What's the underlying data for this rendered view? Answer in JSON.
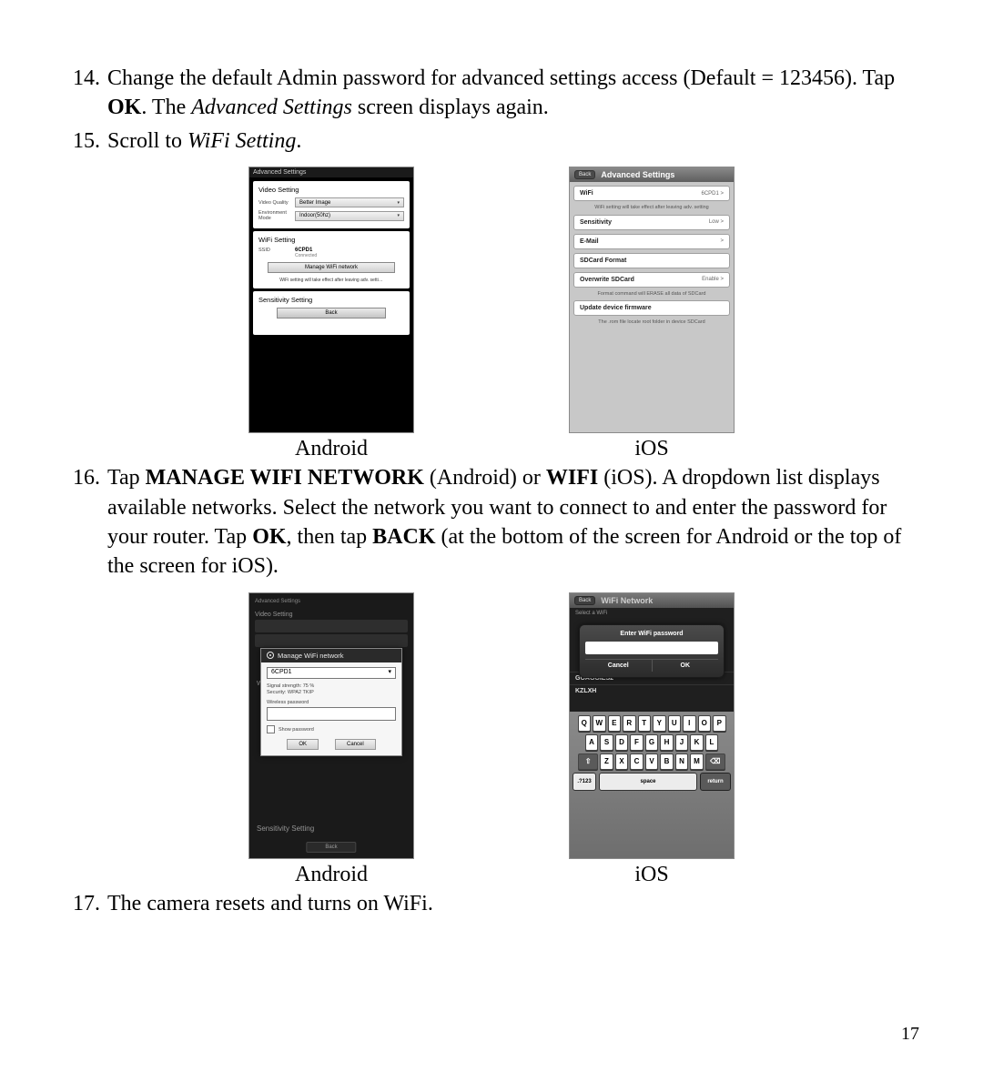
{
  "step14": {
    "num": "14.",
    "text_a": "Change the default Admin password for advanced settings access (Default = 123456). Tap ",
    "ok": "OK",
    "text_b": ". The ",
    "adv": "Advanced Settings",
    "text_c": " screen displays again."
  },
  "step15": {
    "num": "15.",
    "text_a": "Scroll to ",
    "wifi": "WiFi Setting",
    "text_b": "."
  },
  "step16": {
    "num": "16.",
    "text_a": "Tap ",
    "mgn": "MANAGE WIFI NETWORK",
    "text_b": " (Android) or ",
    "wifi": "WIFI",
    "text_c": " (iOS). A dropdown list displays available networks. Select the network you want to connect to and enter the password for your router. Tap ",
    "ok": "OK",
    "text_d": ", then tap ",
    "back": "BACK",
    "text_e": " (at the bottom of the screen for Android or the top of the screen for iOS)."
  },
  "step17": {
    "num": "17.",
    "text": "The camera resets and turns on WiFi."
  },
  "captions": {
    "android": "Android",
    "ios": "iOS"
  },
  "page_number": "17",
  "androidA": {
    "title": "Advanced Settings",
    "video": {
      "heading": "Video Setting",
      "quality_lbl": "Video Quality",
      "quality_val": "Better Image",
      "env_lbl": "Environment Mode",
      "env_val": "Indoor(50hz)"
    },
    "wifi": {
      "heading": "WiFi Setting",
      "ssid_lbl": "SSID",
      "ssid_val": "6CPD1",
      "ssid_status": "Connected",
      "manage_btn": "Manage WiFi network",
      "hint": "WiFi setting will take effect after leaving adv. setti…"
    },
    "sens": {
      "heading": "Sensitivity Setting"
    },
    "back": "Back"
  },
  "iosA": {
    "back": "Back",
    "title": "Advanced Settings",
    "rows": {
      "wifi_k": "WiFi",
      "wifi_v": "6CPD1  >",
      "wifi_note": "WiFi setting will take effect after leaving adv. setting",
      "sens_k": "Sensitivity",
      "sens_v": "Low  >",
      "email_k": "E-Mail",
      "email_v": ">",
      "sdfmt_k": "SDCard Format",
      "ovw_k": "Overwrite SDCard",
      "ovw_v": "Enable  >",
      "ovw_note": "Format command will ERASE all data of SDCard",
      "upd_k": "Update device firmware",
      "upd_note": "The .rom file locate root folder in device SDCard"
    }
  },
  "androidB": {
    "video_setting": "Video Setting",
    "sens_setting": "Sensitivity Setting",
    "back": "Back",
    "dialog": {
      "title": "Manage WiFi network",
      "ssid": "6CPD1",
      "signal": "Signal strength: 75 %",
      "security": "Security: WPA2 TKIP",
      "pw_label": "Wireless password",
      "show_pw": "Show password",
      "ok": "OK",
      "cancel": "Cancel"
    }
  },
  "iosB": {
    "back": "Back",
    "title": "WiFi Network",
    "select_label": "Select a WiFi",
    "items": [
      "GOAGGIES2",
      "KZLXH"
    ],
    "popup": {
      "title": "Enter WiFi password",
      "cancel": "Cancel",
      "ok": "OK"
    },
    "kbd": {
      "r1": [
        "Q",
        "W",
        "E",
        "R",
        "T",
        "Y",
        "U",
        "I",
        "O",
        "P"
      ],
      "r2": [
        "A",
        "S",
        "D",
        "F",
        "G",
        "H",
        "J",
        "K",
        "L"
      ],
      "r3": [
        "⇧",
        "Z",
        "X",
        "C",
        "V",
        "B",
        "N",
        "M",
        "⌫"
      ],
      "sym": ".?123",
      "space": "space",
      "return": "return"
    }
  }
}
